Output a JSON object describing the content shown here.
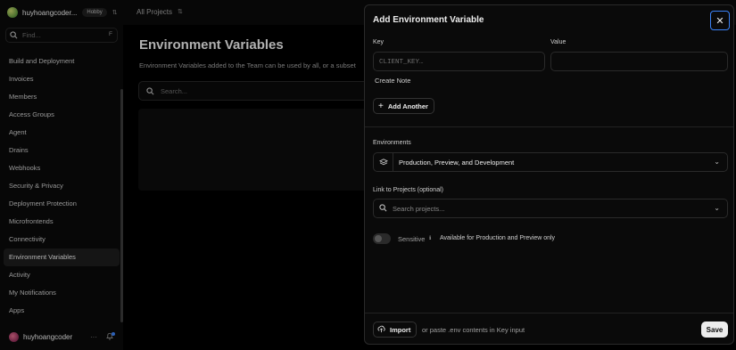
{
  "topbar": {
    "team_name": "huyhoangcoder...",
    "plan_badge": "Hobby",
    "projects_label": "All Projects"
  },
  "sidebar": {
    "find_placeholder": "Find...",
    "find_shortcut": "F",
    "items": [
      {
        "label": "Build and Deployment",
        "active": false
      },
      {
        "label": "Invoices",
        "active": false
      },
      {
        "label": "Members",
        "active": false
      },
      {
        "label": "Access Groups",
        "active": false
      },
      {
        "label": "Agent",
        "active": false
      },
      {
        "label": "Drains",
        "active": false
      },
      {
        "label": "Webhooks",
        "active": false
      },
      {
        "label": "Security & Privacy",
        "active": false
      },
      {
        "label": "Deployment Protection",
        "active": false
      },
      {
        "label": "Microfrontends",
        "active": false
      },
      {
        "label": "Connectivity",
        "active": false
      },
      {
        "label": "Environment Variables",
        "active": true
      },
      {
        "label": "Activity",
        "active": false
      },
      {
        "label": "My Notifications",
        "active": false
      },
      {
        "label": "Apps",
        "active": false
      }
    ],
    "user_name": "huyhoangcoder",
    "user_more": "···"
  },
  "main": {
    "title": "Environment Variables",
    "description": "Environment Variables added to the Team can be used by all, or a subset",
    "search_placeholder": "Search..."
  },
  "modal": {
    "title": "Add Environment Variable",
    "close_symbol": "✕",
    "key_label": "Key",
    "key_placeholder": "CLIENT_KEY…",
    "value_label": "Value",
    "value_placeholder": "",
    "create_note_label": "Create Note",
    "add_another_label": "Add Another",
    "environments_label": "Environments",
    "environments_value": "Production, Preview, and Development",
    "link_projects_label": "Link to Projects (optional)",
    "link_projects_placeholder": "Search projects...",
    "sensitive_label": "Sensitive",
    "sensitive_enabled": false,
    "sensitive_description": "Available for Production and Preview only",
    "import_label": "Import",
    "paste_hint": "or paste .env contents in Key input",
    "save_label": "Save"
  },
  "colors": {
    "background": "#000000",
    "panel": "#0a0a0a",
    "border": "#2a2a2a",
    "focus_ring": "#3b82f6",
    "save_button": "#ededed"
  }
}
